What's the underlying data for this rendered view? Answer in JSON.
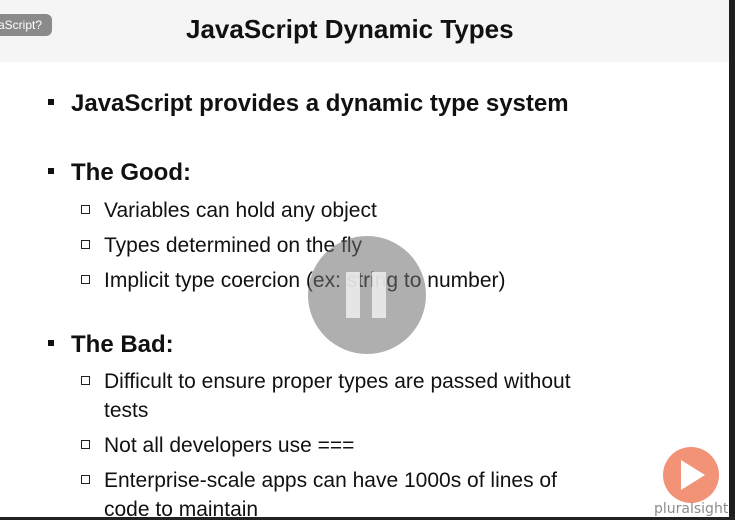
{
  "header": {
    "previous_module_tab": "aScript?",
    "title": "JavaScript Dynamic Types"
  },
  "bullets": {
    "b1": "JavaScript provides a dynamic type system",
    "good": {
      "heading": "The Good:",
      "items": [
        "Variables can hold any object",
        "Types determined on the fly",
        "Implicit type coercion (ex: string to number)"
      ]
    },
    "bad": {
      "heading": "The Bad:",
      "item1_line1": "Difficult to ensure proper types are passed without",
      "item1_line2": "tests",
      "item2": "Not all developers use ===",
      "item3_line1": "Enterprise-scale apps can have 1000s of lines of",
      "item3_line2": "code to maintain"
    }
  },
  "player": {
    "pause_icon": "pause-icon",
    "brand": "pluralsight",
    "brand_icon": "play-logo-icon"
  },
  "colors": {
    "brand": "#f08060",
    "text": "#111111"
  }
}
